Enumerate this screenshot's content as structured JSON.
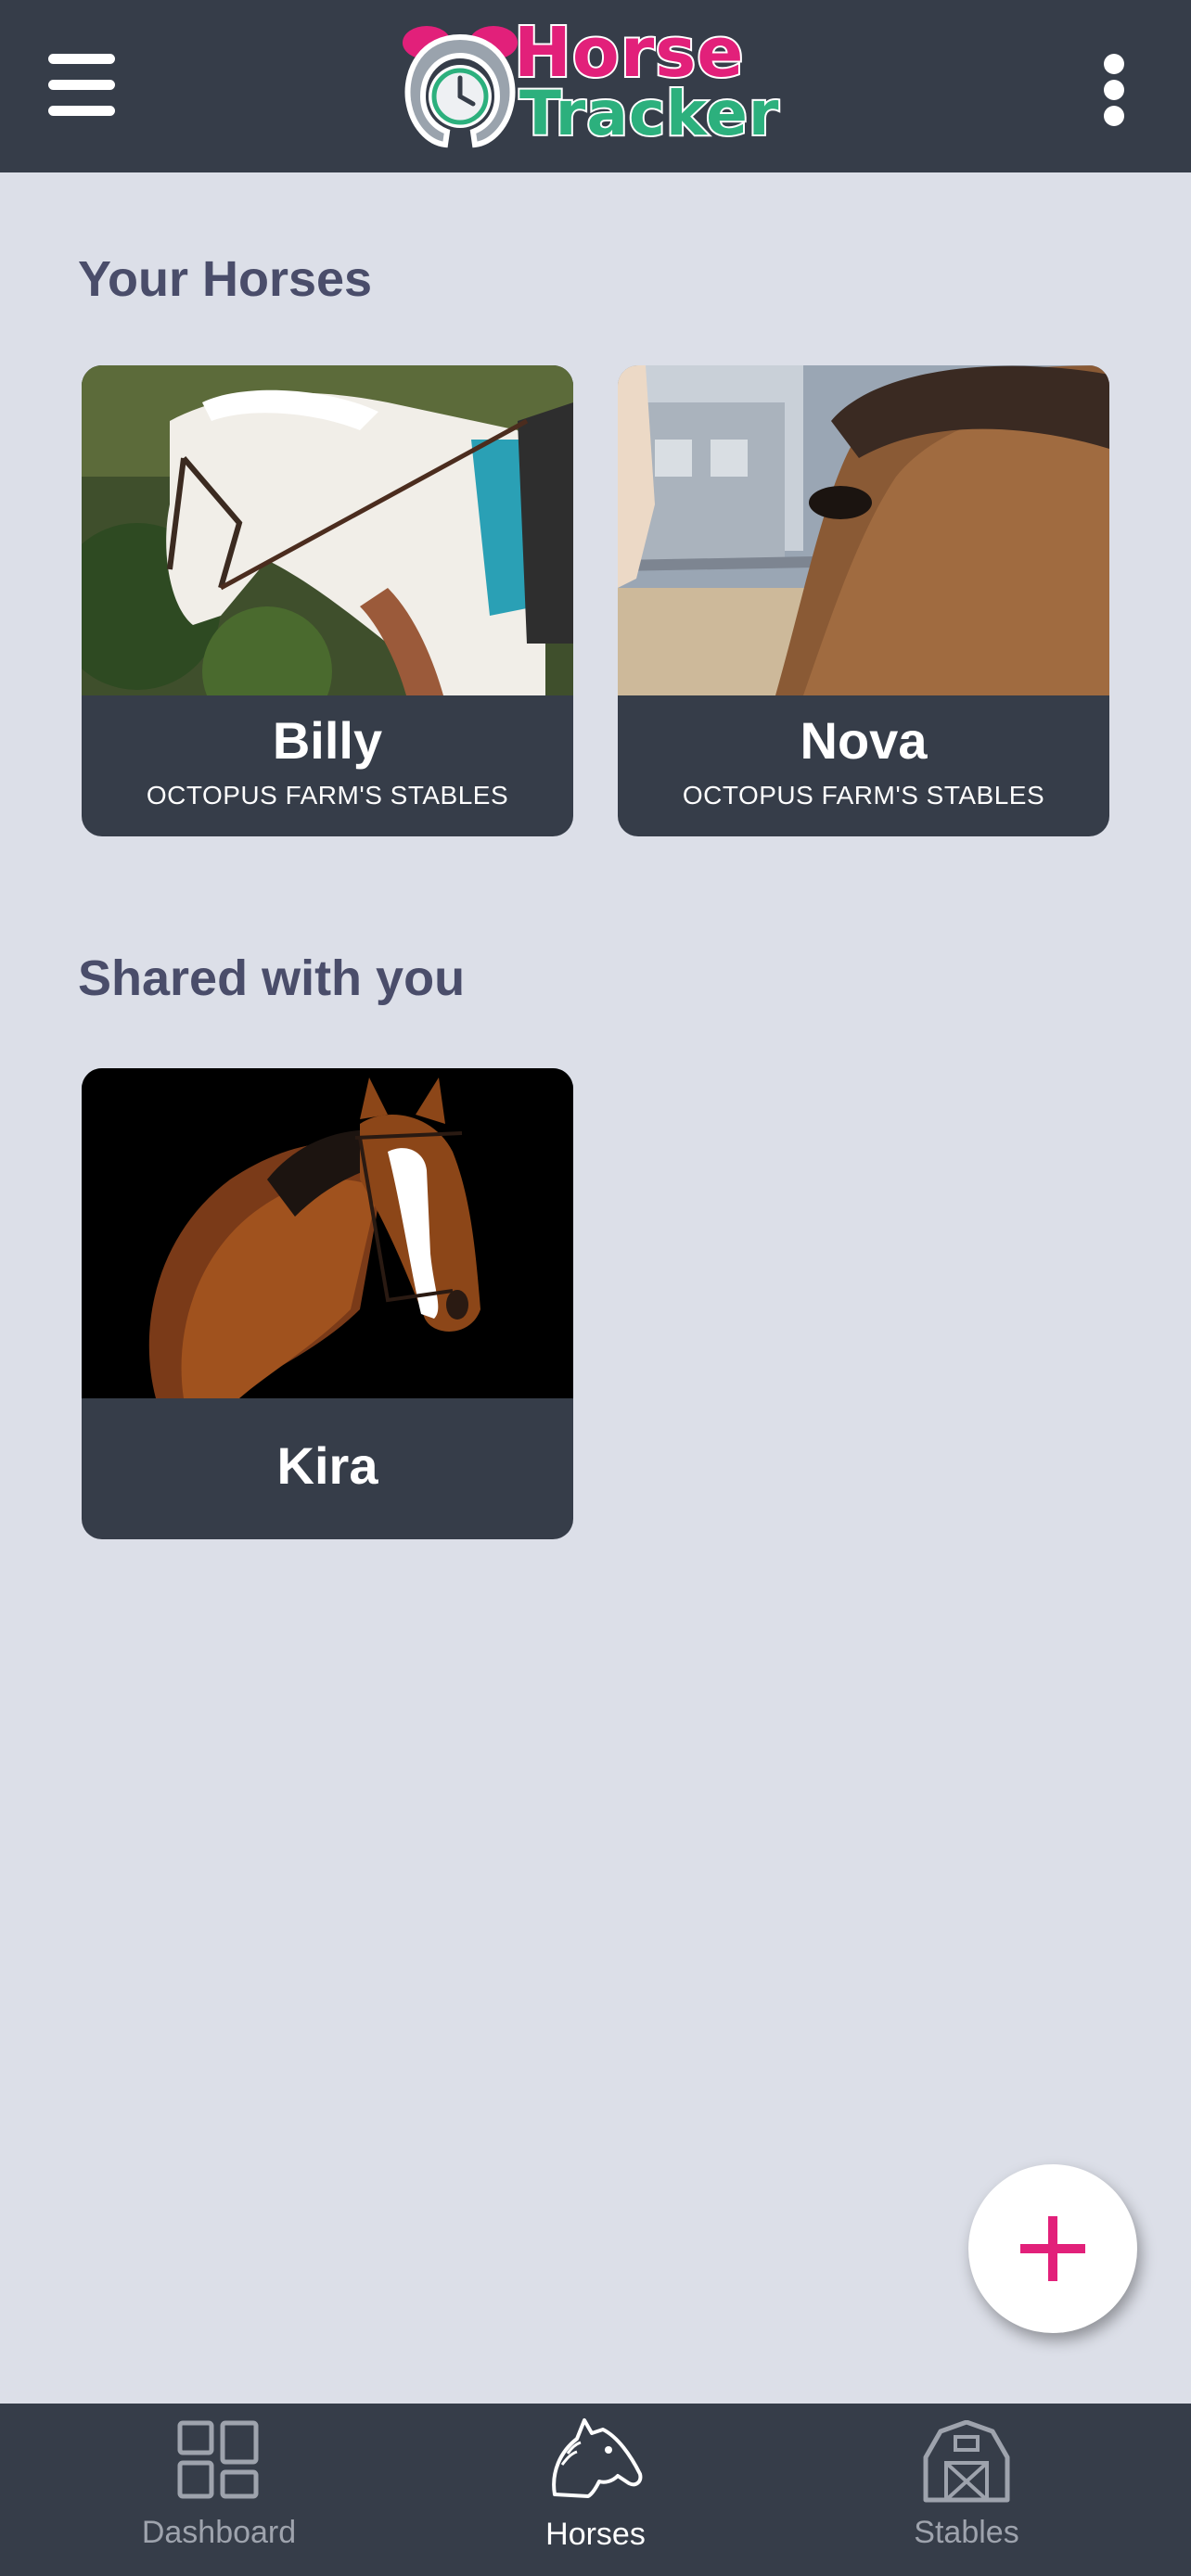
{
  "app": {
    "logo_line1": "Horse",
    "logo_line2": "Tracker"
  },
  "sections": {
    "your_horses": "Your Horses",
    "shared": "Shared with you"
  },
  "horses": [
    {
      "name": "Billy",
      "stable": "OCTOPUS FARM'S STABLES"
    },
    {
      "name": "Nova",
      "stable": "OCTOPUS FARM'S STABLES"
    }
  ],
  "shared_horses": [
    {
      "name": "Kira"
    }
  ],
  "nav": {
    "dashboard": "Dashboard",
    "horses": "Horses",
    "stables": "Stables",
    "active": "horses"
  },
  "icons": {
    "menu": "menu-icon",
    "more": "more-vertical-icon",
    "add": "plus-icon",
    "dashboard": "dashboard-grid-icon",
    "horses": "horse-head-icon",
    "stables": "barn-icon"
  },
  "colors": {
    "bar": "#363d49",
    "background": "#dcdfe8",
    "accent_pink": "#e2207a",
    "accent_green": "#2cb07d",
    "heading": "#4a4d6a"
  }
}
